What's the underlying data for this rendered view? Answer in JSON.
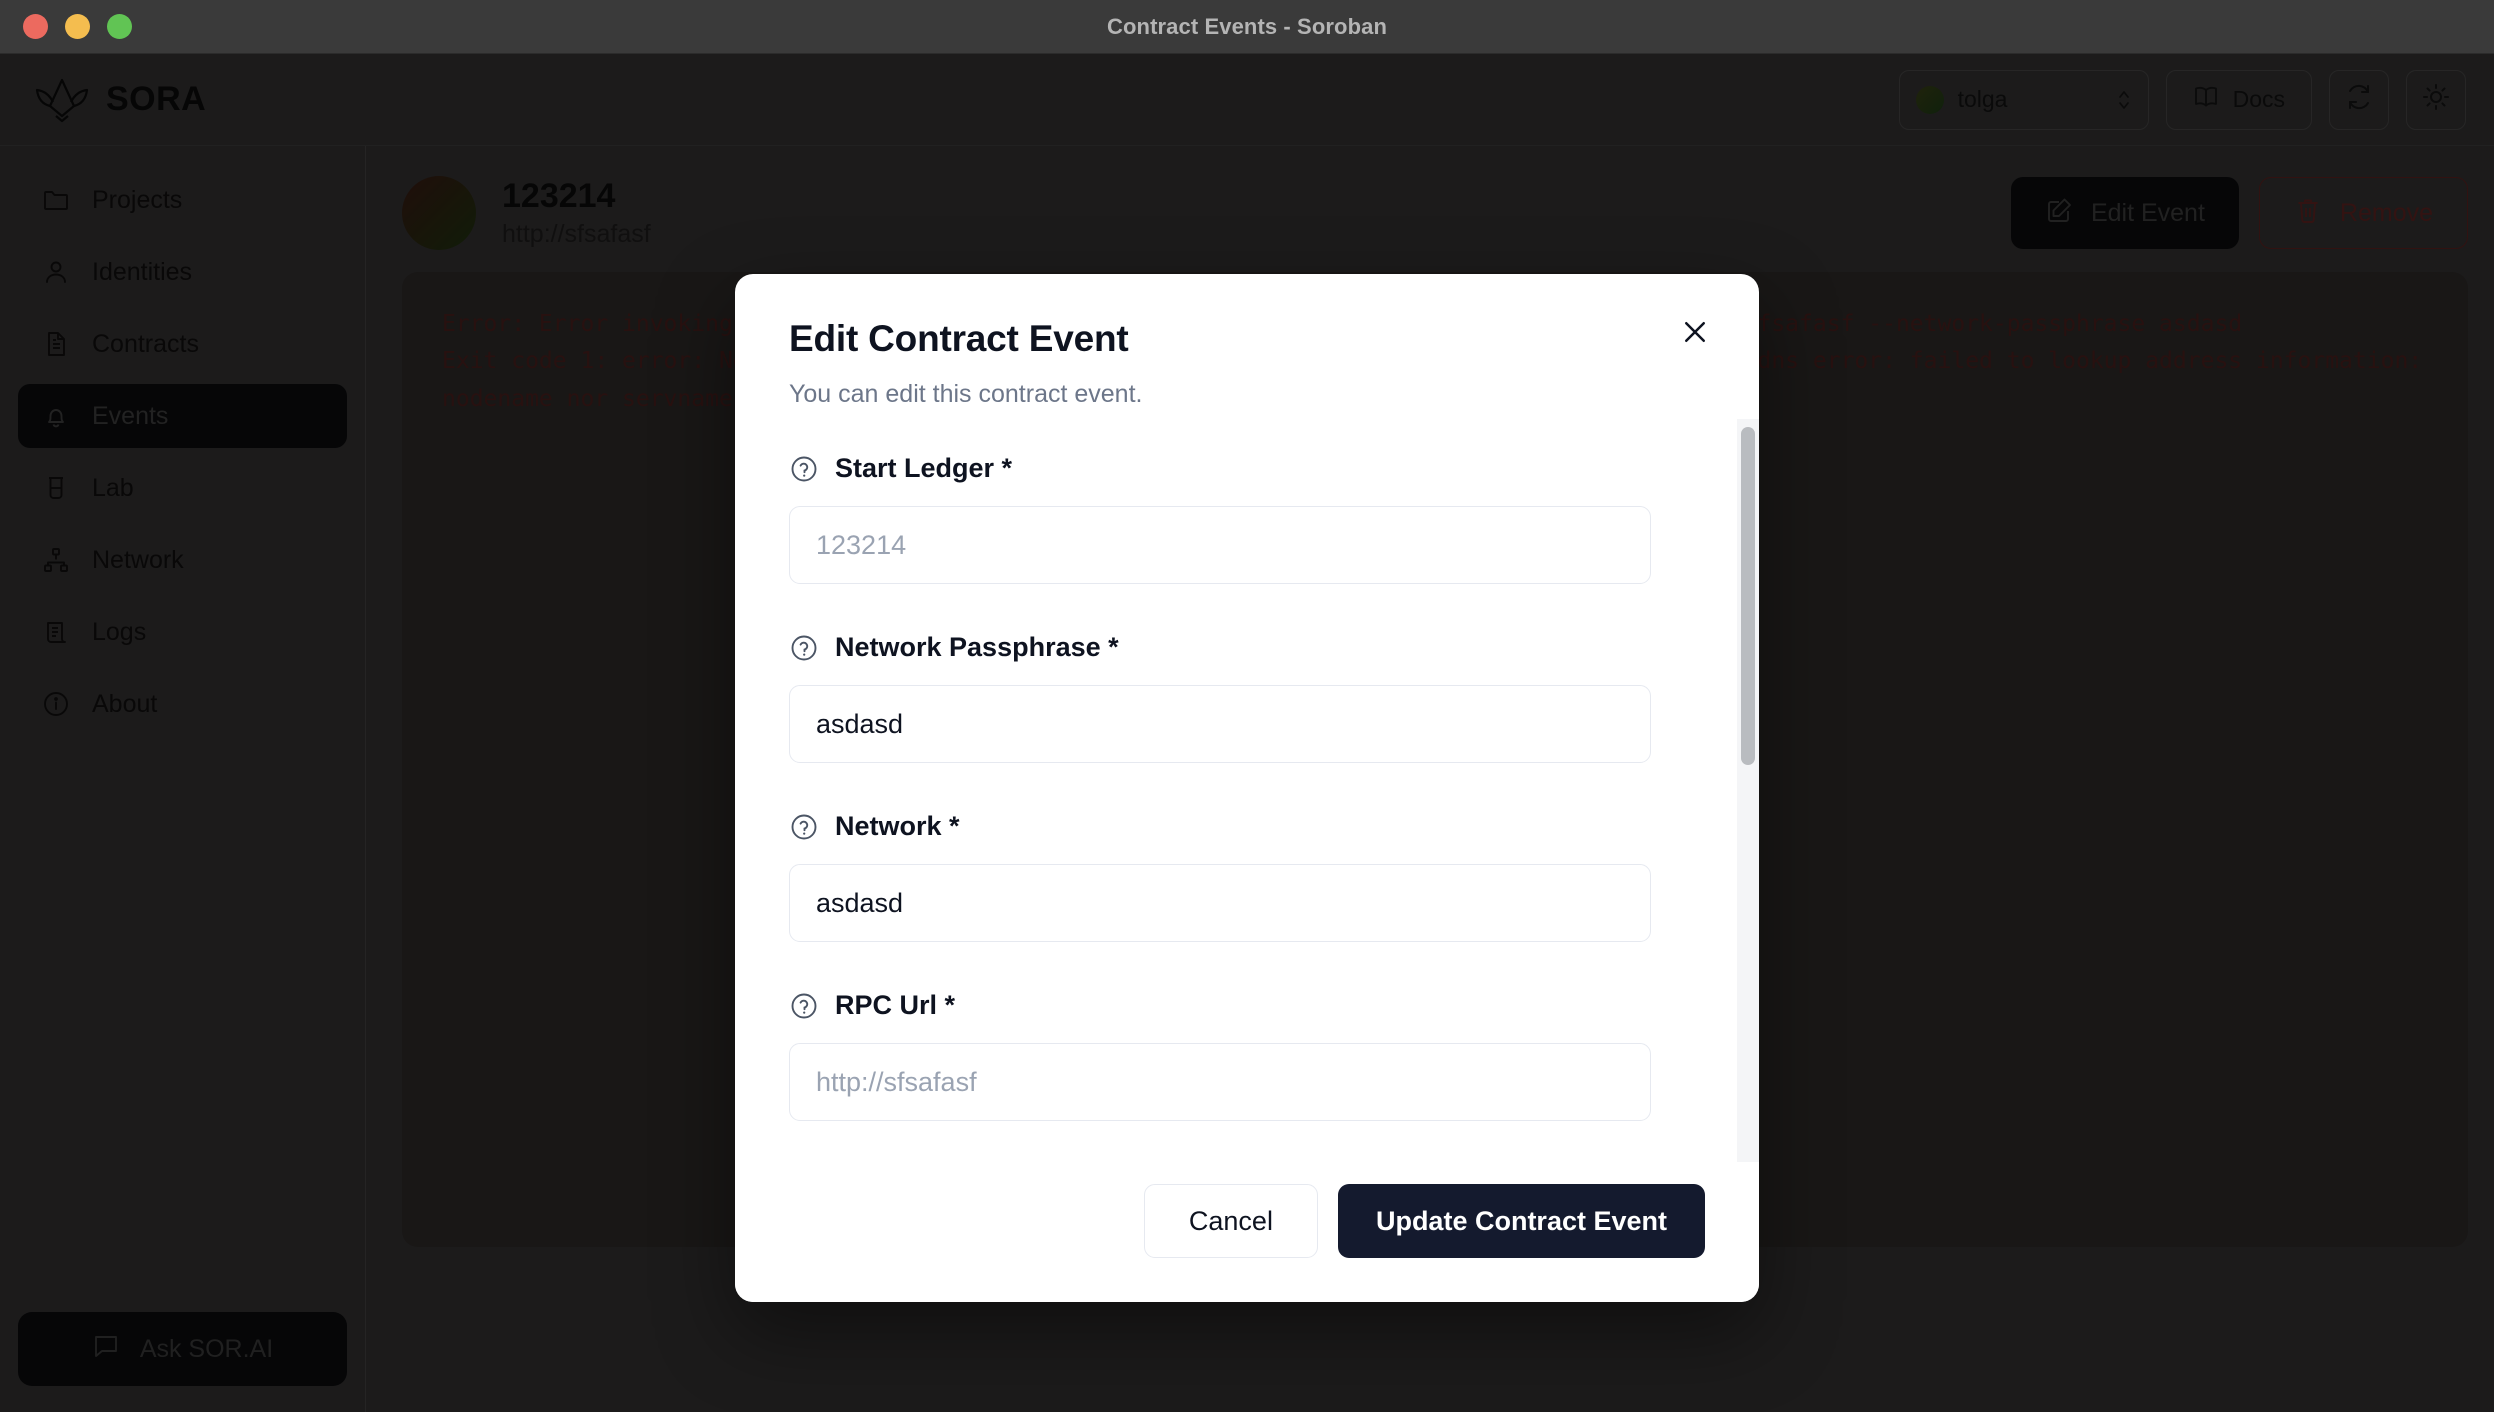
{
  "window": {
    "title": "Contract Events - Soroban",
    "traffic_lights": [
      "close",
      "minimize",
      "zoom"
    ]
  },
  "topbar": {
    "brand": "SORA",
    "profile": {
      "name": "tolga",
      "icon": "avatar-dot",
      "chevron": "chevron-up-down-icon"
    },
    "docs": {
      "label": "Docs",
      "icon": "book-icon"
    },
    "refresh": {
      "icon": "refresh-icon"
    },
    "theme": {
      "icon": "sun-icon"
    }
  },
  "sidebar": {
    "items": [
      {
        "label": "Projects",
        "icon": "folder-icon",
        "active": false
      },
      {
        "label": "Identities",
        "icon": "user-icon",
        "active": false
      },
      {
        "label": "Contracts",
        "icon": "document-icon",
        "active": false
      },
      {
        "label": "Events",
        "icon": "bell-icon",
        "active": true
      },
      {
        "label": "Lab",
        "icon": "beaker-icon",
        "active": false
      },
      {
        "label": "Network",
        "icon": "network-icon",
        "active": false
      },
      {
        "label": "Logs",
        "icon": "logs-icon",
        "active": false
      },
      {
        "label": "About",
        "icon": "info-icon",
        "active": false
      }
    ],
    "ask_button": {
      "label": "Ask SOR.AI",
      "icon": "chat-bubble-icon"
    }
  },
  "page": {
    "event_title": "123214",
    "event_url": "http://sfsafasf",
    "edit_button": {
      "label": "Edit Event",
      "icon": "pencil-square-icon"
    },
    "remove_button": {
      "label": "Remove",
      "icon": "trash-icon"
    },
    "error_output": "Error: Error invoking command: soroban contract events --start-ledger 123214 --rpc-url http://sfsafasf --network-passphrase asdasd\nExit code 1: error: Networking or low-level protocol error: Error(0): error trying to connect: dns error: failed to lookup address information: nodename nor servname provided, or not known"
  },
  "modal": {
    "title": "Edit Contract Event",
    "subtitle": "You can edit this contract event.",
    "close_icon": "close-icon",
    "fields": [
      {
        "label": "Start Ledger *",
        "value": "",
        "placeholder": "123214",
        "help_icon": "help-circle-icon"
      },
      {
        "label": "Network Passphrase *",
        "value": "asdasd",
        "placeholder": "",
        "help_icon": "help-circle-icon"
      },
      {
        "label": "Network *",
        "value": "asdasd",
        "placeholder": "",
        "help_icon": "help-circle-icon"
      },
      {
        "label": "RPC Url *",
        "value": "",
        "placeholder": "http://sfsafasf",
        "help_icon": "help-circle-icon"
      }
    ],
    "cancel_label": "Cancel",
    "submit_label": "Update Contract Event"
  },
  "colors": {
    "primary": "#141a2e",
    "danger": "#5e2321",
    "error_text": "#4a201e",
    "modal_bg": "#ffffff",
    "app_bg": "#333232"
  }
}
